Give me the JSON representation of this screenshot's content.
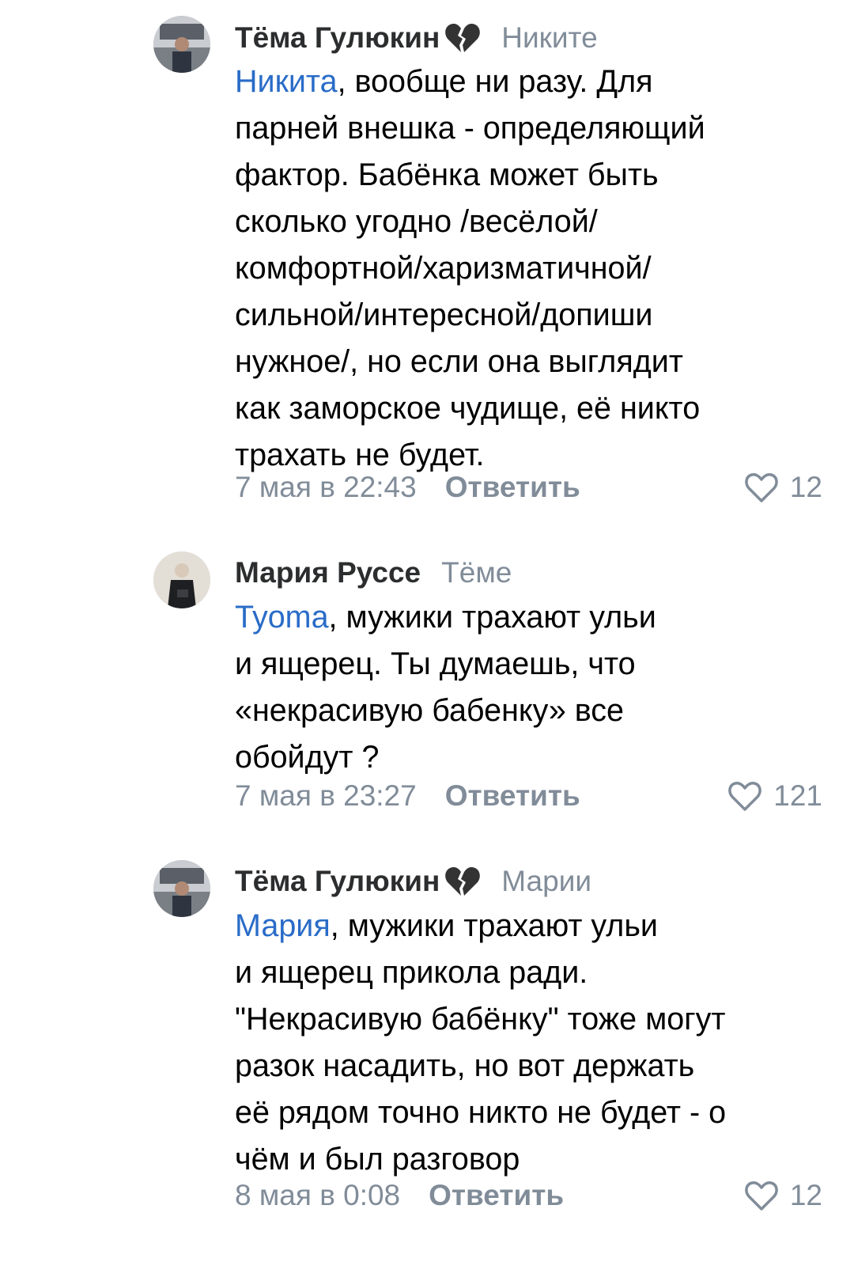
{
  "comments": [
    {
      "author": "Тёма Гулюкин",
      "author_emoji": "broken-heart-icon",
      "reply_to": "Никите",
      "mention": "Никита",
      "text": ", вообще ни разу. Для\nпарней внешка - определяющий\nфактор. Бабёнка может быть\nсколько угодно /весёлой/\nкомфортной/харизматичной/\nсильной/интересной/допиши\nнужное/, но если она выглядит\nкак заморское чудище, её никто\nтрахать не будет.",
      "date": "7 мая в 22:43",
      "reply_label": "Ответить",
      "likes": "12"
    },
    {
      "author": "Мария Руссе",
      "reply_to": "Тёме",
      "mention": "Tyoma",
      "text": ", мужики трахают ульи\nи ящерец. Ты думаешь, что\n«некрасивую бабенку» все\nобойдут ?",
      "date": "7 мая в 23:27",
      "reply_label": "Ответить",
      "likes": "121"
    },
    {
      "author": "Тёма Гулюкин",
      "author_emoji": "broken-heart-icon",
      "reply_to": "Марии",
      "mention": "Мария",
      "text": ", мужики трахают ульи\nи ящерец прикола ради.\n\"Некрасивую бабёнку\" тоже могут\nразок насадить, но вот держать\nеё рядом точно никто не будет - о\nчём и был разговор",
      "date": "8 мая в 0:08",
      "reply_label": "Ответить",
      "likes": "12"
    }
  ],
  "colors": {
    "author": "#2c2d2e",
    "secondary": "#818c99",
    "mention": "#2a6cc8",
    "text": "#000000"
  }
}
